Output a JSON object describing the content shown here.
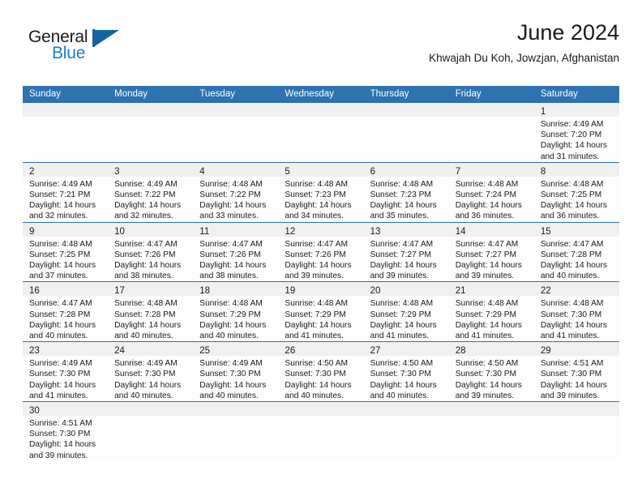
{
  "brand": {
    "name_top": "General",
    "name_bottom": "Blue",
    "accent_color": "#1f7ac4",
    "flag_color": "#14659e"
  },
  "header": {
    "title": "June 2024",
    "subtitle": "Khwajah Du Koh, Jowzjan, Afghanistan"
  },
  "theme": {
    "header_bg": "#2e72b0",
    "daynum_bg": "#f0f0f0",
    "cell_bg": "#fdfdfd",
    "text": "#1a1a1a"
  },
  "weekdays": [
    "Sunday",
    "Monday",
    "Tuesday",
    "Wednesday",
    "Thursday",
    "Friday",
    "Saturday"
  ],
  "labels": {
    "sunrise_prefix": "Sunrise:",
    "sunset_prefix": "Sunset:",
    "daylight_prefix": "Daylight:"
  },
  "weeks": [
    [
      {
        "empty": true
      },
      {
        "empty": true
      },
      {
        "empty": true
      },
      {
        "empty": true
      },
      {
        "empty": true
      },
      {
        "empty": true
      },
      {
        "day": "1",
        "sunrise": "Sunrise: 4:49 AM",
        "sunset": "Sunset: 7:20 PM",
        "daylight_1": "Daylight: 14 hours",
        "daylight_2": "and 31 minutes."
      }
    ],
    [
      {
        "day": "2",
        "sunrise": "Sunrise: 4:49 AM",
        "sunset": "Sunset: 7:21 PM",
        "daylight_1": "Daylight: 14 hours",
        "daylight_2": "and 32 minutes."
      },
      {
        "day": "3",
        "sunrise": "Sunrise: 4:49 AM",
        "sunset": "Sunset: 7:22 PM",
        "daylight_1": "Daylight: 14 hours",
        "daylight_2": "and 32 minutes."
      },
      {
        "day": "4",
        "sunrise": "Sunrise: 4:48 AM",
        "sunset": "Sunset: 7:22 PM",
        "daylight_1": "Daylight: 14 hours",
        "daylight_2": "and 33 minutes."
      },
      {
        "day": "5",
        "sunrise": "Sunrise: 4:48 AM",
        "sunset": "Sunset: 7:23 PM",
        "daylight_1": "Daylight: 14 hours",
        "daylight_2": "and 34 minutes."
      },
      {
        "day": "6",
        "sunrise": "Sunrise: 4:48 AM",
        "sunset": "Sunset: 7:23 PM",
        "daylight_1": "Daylight: 14 hours",
        "daylight_2": "and 35 minutes."
      },
      {
        "day": "7",
        "sunrise": "Sunrise: 4:48 AM",
        "sunset": "Sunset: 7:24 PM",
        "daylight_1": "Daylight: 14 hours",
        "daylight_2": "and 36 minutes."
      },
      {
        "day": "8",
        "sunrise": "Sunrise: 4:48 AM",
        "sunset": "Sunset: 7:25 PM",
        "daylight_1": "Daylight: 14 hours",
        "daylight_2": "and 36 minutes."
      }
    ],
    [
      {
        "day": "9",
        "sunrise": "Sunrise: 4:48 AM",
        "sunset": "Sunset: 7:25 PM",
        "daylight_1": "Daylight: 14 hours",
        "daylight_2": "and 37 minutes."
      },
      {
        "day": "10",
        "sunrise": "Sunrise: 4:47 AM",
        "sunset": "Sunset: 7:26 PM",
        "daylight_1": "Daylight: 14 hours",
        "daylight_2": "and 38 minutes."
      },
      {
        "day": "11",
        "sunrise": "Sunrise: 4:47 AM",
        "sunset": "Sunset: 7:26 PM",
        "daylight_1": "Daylight: 14 hours",
        "daylight_2": "and 38 minutes."
      },
      {
        "day": "12",
        "sunrise": "Sunrise: 4:47 AM",
        "sunset": "Sunset: 7:26 PM",
        "daylight_1": "Daylight: 14 hours",
        "daylight_2": "and 39 minutes."
      },
      {
        "day": "13",
        "sunrise": "Sunrise: 4:47 AM",
        "sunset": "Sunset: 7:27 PM",
        "daylight_1": "Daylight: 14 hours",
        "daylight_2": "and 39 minutes."
      },
      {
        "day": "14",
        "sunrise": "Sunrise: 4:47 AM",
        "sunset": "Sunset: 7:27 PM",
        "daylight_1": "Daylight: 14 hours",
        "daylight_2": "and 39 minutes."
      },
      {
        "day": "15",
        "sunrise": "Sunrise: 4:47 AM",
        "sunset": "Sunset: 7:28 PM",
        "daylight_1": "Daylight: 14 hours",
        "daylight_2": "and 40 minutes."
      }
    ],
    [
      {
        "day": "16",
        "sunrise": "Sunrise: 4:47 AM",
        "sunset": "Sunset: 7:28 PM",
        "daylight_1": "Daylight: 14 hours",
        "daylight_2": "and 40 minutes."
      },
      {
        "day": "17",
        "sunrise": "Sunrise: 4:48 AM",
        "sunset": "Sunset: 7:28 PM",
        "daylight_1": "Daylight: 14 hours",
        "daylight_2": "and 40 minutes."
      },
      {
        "day": "18",
        "sunrise": "Sunrise: 4:48 AM",
        "sunset": "Sunset: 7:29 PM",
        "daylight_1": "Daylight: 14 hours",
        "daylight_2": "and 40 minutes."
      },
      {
        "day": "19",
        "sunrise": "Sunrise: 4:48 AM",
        "sunset": "Sunset: 7:29 PM",
        "daylight_1": "Daylight: 14 hours",
        "daylight_2": "and 41 minutes."
      },
      {
        "day": "20",
        "sunrise": "Sunrise: 4:48 AM",
        "sunset": "Sunset: 7:29 PM",
        "daylight_1": "Daylight: 14 hours",
        "daylight_2": "and 41 minutes."
      },
      {
        "day": "21",
        "sunrise": "Sunrise: 4:48 AM",
        "sunset": "Sunset: 7:29 PM",
        "daylight_1": "Daylight: 14 hours",
        "daylight_2": "and 41 minutes."
      },
      {
        "day": "22",
        "sunrise": "Sunrise: 4:48 AM",
        "sunset": "Sunset: 7:30 PM",
        "daylight_1": "Daylight: 14 hours",
        "daylight_2": "and 41 minutes."
      }
    ],
    [
      {
        "day": "23",
        "sunrise": "Sunrise: 4:49 AM",
        "sunset": "Sunset: 7:30 PM",
        "daylight_1": "Daylight: 14 hours",
        "daylight_2": "and 41 minutes."
      },
      {
        "day": "24",
        "sunrise": "Sunrise: 4:49 AM",
        "sunset": "Sunset: 7:30 PM",
        "daylight_1": "Daylight: 14 hours",
        "daylight_2": "and 40 minutes."
      },
      {
        "day": "25",
        "sunrise": "Sunrise: 4:49 AM",
        "sunset": "Sunset: 7:30 PM",
        "daylight_1": "Daylight: 14 hours",
        "daylight_2": "and 40 minutes."
      },
      {
        "day": "26",
        "sunrise": "Sunrise: 4:50 AM",
        "sunset": "Sunset: 7:30 PM",
        "daylight_1": "Daylight: 14 hours",
        "daylight_2": "and 40 minutes."
      },
      {
        "day": "27",
        "sunrise": "Sunrise: 4:50 AM",
        "sunset": "Sunset: 7:30 PM",
        "daylight_1": "Daylight: 14 hours",
        "daylight_2": "and 40 minutes."
      },
      {
        "day": "28",
        "sunrise": "Sunrise: 4:50 AM",
        "sunset": "Sunset: 7:30 PM",
        "daylight_1": "Daylight: 14 hours",
        "daylight_2": "and 39 minutes."
      },
      {
        "day": "29",
        "sunrise": "Sunrise: 4:51 AM",
        "sunset": "Sunset: 7:30 PM",
        "daylight_1": "Daylight: 14 hours",
        "daylight_2": "and 39 minutes."
      }
    ],
    [
      {
        "day": "30",
        "sunrise": "Sunrise: 4:51 AM",
        "sunset": "Sunset: 7:30 PM",
        "daylight_1": "Daylight: 14 hours",
        "daylight_2": "and 39 minutes."
      },
      {
        "empty": true
      },
      {
        "empty": true
      },
      {
        "empty": true
      },
      {
        "empty": true
      },
      {
        "empty": true
      },
      {
        "empty": true
      }
    ]
  ]
}
